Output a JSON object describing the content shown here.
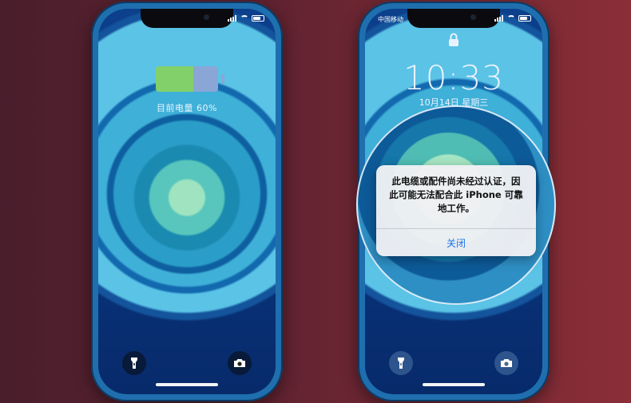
{
  "left_phone": {
    "battery_level": 0.6,
    "charging_text": "目前电量 60%",
    "flashlight_icon": "flashlight-icon",
    "camera_icon": "camera-icon"
  },
  "right_phone": {
    "carrier": "中国移动",
    "time": "10:33",
    "date": "10月14日 星期三",
    "lock_icon": "lock-icon",
    "alert": {
      "message": "此电缆或配件尚未经过认证，因此可能无法配合此 iPhone 可靠地工作。",
      "button_label": "关闭"
    }
  },
  "colors": {
    "battery_fill": "#82d06a",
    "battery_empty": "#8aa6d6",
    "alert_button": "#1a73e8",
    "phone_frame": "#1f6fae"
  }
}
